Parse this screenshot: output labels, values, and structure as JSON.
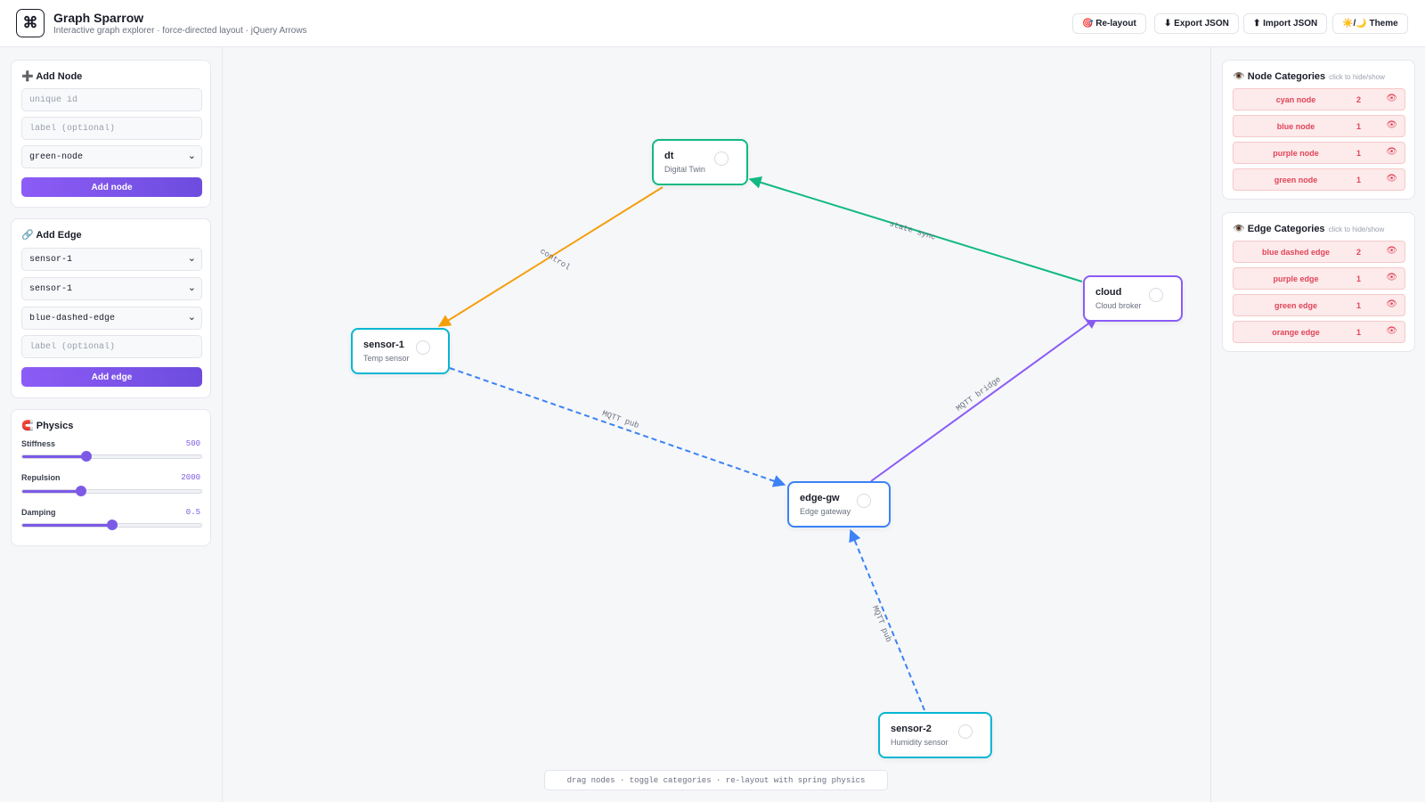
{
  "header": {
    "title": "Graph Sparrow",
    "subtitle": "Interactive graph explorer · force-directed layout · jQuery Arrows",
    "logo_glyph": "⌘",
    "buttons": {
      "relayout": "🎯 Re-layout",
      "export": "⬇ Export JSON",
      "import": "⬆ Import JSON",
      "theme": "☀️/🌙 Theme"
    }
  },
  "add_node": {
    "title": "➕ Add Node",
    "id_placeholder": "unique id",
    "label_placeholder": "label (optional)",
    "category_value": "green-node",
    "category_options": [
      "green-node"
    ],
    "button": "Add node"
  },
  "add_edge": {
    "title": "🔗 Add Edge",
    "from_value": "sensor-1",
    "from_options": [
      "sensor-1"
    ],
    "to_value": "sensor-1",
    "to_options": [
      "sensor-1"
    ],
    "category_value": "blue-dashed-edge",
    "category_options": [
      "blue-dashed-edge"
    ],
    "label_placeholder": "label (optional)",
    "button": "Add edge"
  },
  "physics": {
    "title": "🧲 Physics",
    "stiffness": {
      "label": "Stiffness",
      "value": "500",
      "fraction": 0.36
    },
    "repulsion": {
      "label": "Repulsion",
      "value": "2000",
      "fraction": 0.33
    },
    "damping": {
      "label": "Damping",
      "value": "0.5",
      "fraction": 0.5
    }
  },
  "graph": {
    "nodes": [
      {
        "id": "dt",
        "label": "Digital Twin",
        "color": "#10b981"
      },
      {
        "id": "sensor-1",
        "label": "Temp sensor",
        "color": "#06b6d4"
      },
      {
        "id": "cloud",
        "label": "Cloud broker",
        "color": "#8b5cf6"
      },
      {
        "id": "edge-gw",
        "label": "Edge gateway",
        "color": "#3b82f6"
      },
      {
        "id": "sensor-2",
        "label": "Humidity sensor",
        "color": "#06b6d4"
      }
    ],
    "edges": [
      {
        "from": "dt",
        "to": "sensor-1",
        "label": "control",
        "color": "#f59e0b",
        "dashed": false
      },
      {
        "from": "cloud",
        "to": "dt",
        "label": "state sync",
        "color": "#10b981",
        "dashed": false
      },
      {
        "from": "sensor-1",
        "to": "edge-gw",
        "label": "MQTT pub",
        "color": "#3b82f6",
        "dashed": true
      },
      {
        "from": "edge-gw",
        "to": "cloud",
        "label": "MQTT bridge",
        "color": "#8b5cf6",
        "dashed": false
      },
      {
        "from": "sensor-2",
        "to": "edge-gw",
        "label": "MQTT pub",
        "color": "#3b82f6",
        "dashed": true
      }
    ]
  },
  "footer_hint": "drag nodes · toggle categories · re-layout with spring physics",
  "node_categories": {
    "title": "👁️ Node Categories",
    "hint": "click to hide/show",
    "eye_icon": "👁",
    "items": [
      {
        "name": "cyan node",
        "count": "2"
      },
      {
        "name": "blue node",
        "count": "1"
      },
      {
        "name": "purple node",
        "count": "1"
      },
      {
        "name": "green node",
        "count": "1"
      }
    ]
  },
  "edge_categories": {
    "title": "👁️ Edge Categories",
    "hint": "click to hide/show",
    "eye_icon": "👁",
    "items": [
      {
        "name": "blue dashed edge",
        "count": "2"
      },
      {
        "name": "purple edge",
        "count": "1"
      },
      {
        "name": "green edge",
        "count": "1"
      },
      {
        "name": "orange edge",
        "count": "1"
      }
    ]
  }
}
